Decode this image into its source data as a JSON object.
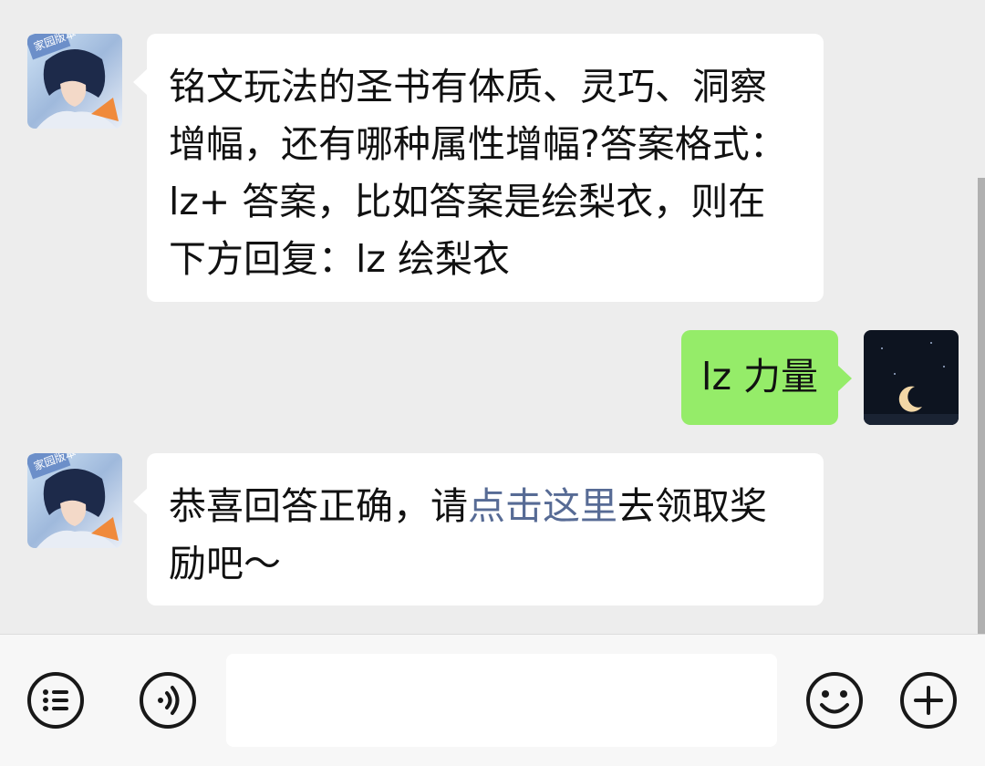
{
  "messages": {
    "m1": {
      "text": "铭文玩法的圣书有体质、灵巧、洞察增幅，还有哪种属性增幅?答案格式：lz+ 答案，比如答案是绘梨衣，则在下方回复：lz 绘梨衣"
    },
    "m2": {
      "text": "lz 力量"
    },
    "m3": {
      "text_before": "恭喜回答正确，请",
      "link": "点击这里",
      "text_after": "去领取奖励吧～"
    }
  },
  "bot_avatar": {
    "badge": "家园版本"
  },
  "input": {
    "placeholder": "",
    "value": ""
  },
  "colors": {
    "background": "#ededed",
    "bubble_received": "#ffffff",
    "bubble_sent": "#95ec69",
    "link": "#576b95",
    "input_bar": "#f7f7f7"
  },
  "icons": {
    "voice": "voice-icon",
    "emoji": "emoji-icon",
    "more": "plus-icon",
    "menu": "list-icon"
  }
}
